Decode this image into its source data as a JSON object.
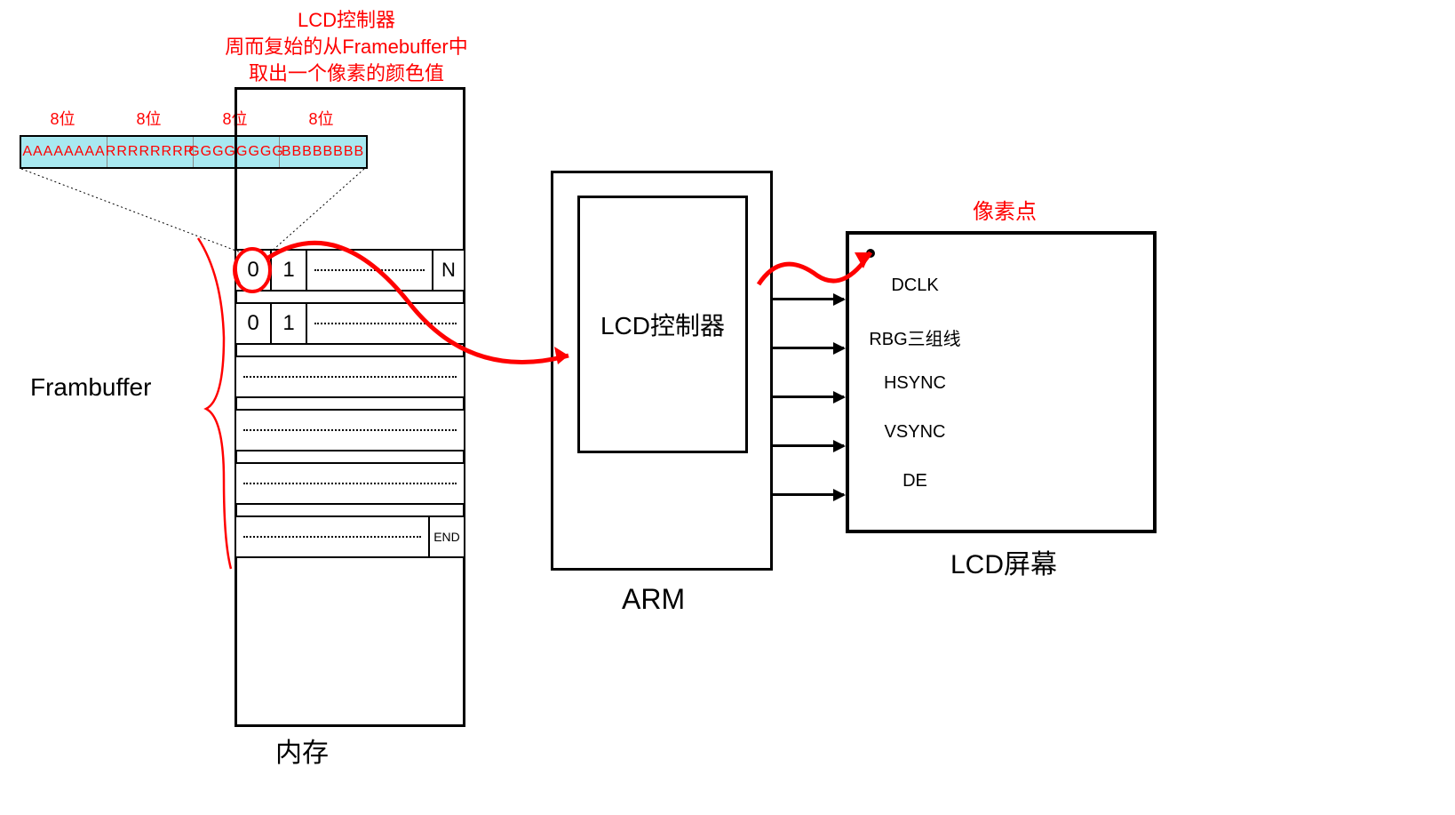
{
  "title": {
    "line1": "LCD控制器",
    "line2": "周而复始的从Framebuffer中",
    "line3": "取出一个像素的颜色值"
  },
  "bits_label": "8位",
  "bytes": {
    "a": "AAAAAAAA",
    "r": "RRRRRRRR",
    "g": "GGGGGGGG",
    "b": "BBBBBBBB"
  },
  "framebuffer": {
    "label": "Frambuffer",
    "cell0": "0",
    "cell1": "1",
    "cellN": "N",
    "end": "END"
  },
  "memory_label": "内存",
  "lcd_controller": "LCD控制器",
  "arm_label": "ARM",
  "signals": {
    "dclk": "DCLK",
    "rgb": "RBG三组线",
    "hsync": "HSYNC",
    "vsync": "VSYNC",
    "de": "DE"
  },
  "lcd_screen_label": "LCD屏幕",
  "pixel_label": "像素点"
}
